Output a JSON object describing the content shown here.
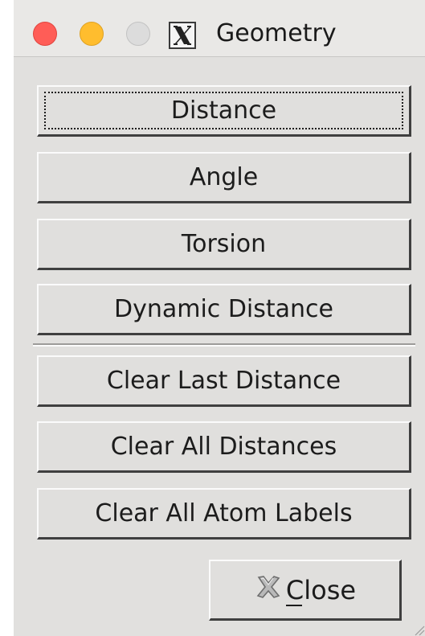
{
  "window": {
    "title": "Geometry"
  },
  "buttons": {
    "distance": "Distance",
    "angle": "Angle",
    "torsion": "Torsion",
    "dynamic_distance": "Dynamic Distance",
    "clear_last_distance": "Clear Last Distance",
    "clear_all_distances": "Clear All Distances",
    "clear_all_atom_labels": "Clear All Atom Labels"
  },
  "close_button": {
    "label_first": "C",
    "label_rest": "lose",
    "icon": "close-x-icon"
  },
  "colors": {
    "traffic_close": "#ff5d57",
    "traffic_minimize": "#ffbd2e",
    "traffic_zoom": "#dcdcdc",
    "window_bg": "#e1e0de"
  }
}
